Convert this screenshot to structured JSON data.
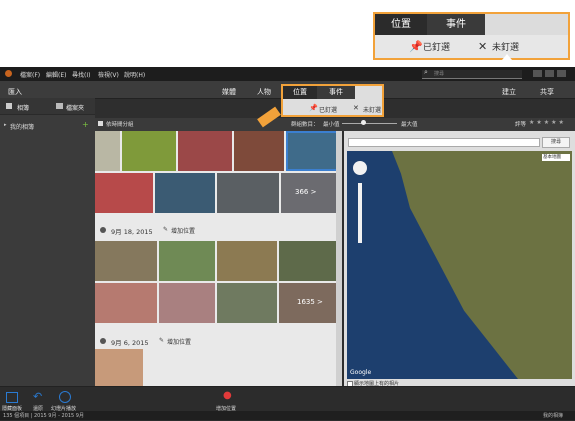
{
  "callout": {
    "tabs": [
      "位置",
      "事件"
    ],
    "pinned_label": "已釘選",
    "unpinned_label": "未釘選"
  },
  "menubar": {
    "items": [
      "檔案(F)",
      "編輯(E)",
      "尋找(I)",
      "檢視(V)",
      "說明(H)"
    ],
    "search_placeholder": "搜尋"
  },
  "topbar": {
    "import_label": "匯入",
    "nav": [
      "媒體",
      "人物",
      "位置",
      "事件"
    ],
    "create_label": "建立",
    "share_label": "共享"
  },
  "sidebar": {
    "albums_label": "相簿",
    "folders_label": "檔案夾",
    "my_albums_label": "我的相簿"
  },
  "popup": {
    "tabs": [
      "位置",
      "事件"
    ],
    "pinned_label": "已釘選",
    "unpinned_label": "未釘選"
  },
  "optbar": {
    "checkbox_label": "依時間分組",
    "group_count_label": "群組數目：",
    "min_label": "最小值",
    "max_label": "最大值",
    "rating_label": "評等"
  },
  "groups": [
    {
      "date": "9月 18, 2015",
      "add_location": "增加位置",
      "count_badge": "1635 >"
    },
    {
      "date": "9月 6, 2015",
      "add_location": "增加位置"
    }
  ],
  "first_group_badge": "366 >",
  "map": {
    "search_button": "搜尋",
    "map_type": "基本地圖",
    "show_in_map_label": "顯示地圖上有的相片",
    "attribution": "Google"
  },
  "bottombar": {
    "items": [
      "隱藏面板",
      "還原",
      "幻燈片播放"
    ],
    "add_location_label": "增加位置"
  },
  "statusbar": {
    "left": "135 個項目 | 2015 9月 - 2015 9月",
    "right": "我的相簿"
  },
  "colors": {
    "accent": "#f2a23a",
    "panel": "#3b3b3b",
    "dark": "#1d1d1d"
  }
}
